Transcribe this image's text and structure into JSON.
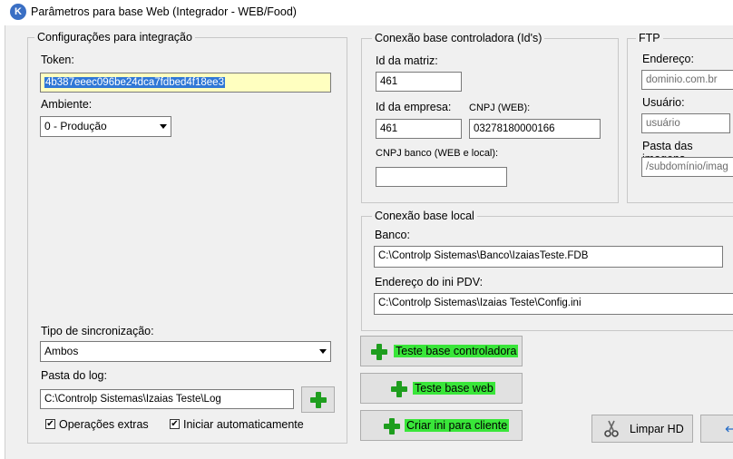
{
  "window": {
    "title": "Parâmetros para base Web (Integrador - WEB/Food)"
  },
  "integracao": {
    "legend": "Configurações para integração",
    "token_label": "Token:",
    "token_value": "4b387eeec096be24dca7fdbed4f18ee3",
    "ambiente_label": "Ambiente:",
    "ambiente_value": "0 - Produção",
    "tipo_sync_label": "Tipo de sincronização:",
    "tipo_sync_value": "Ambos",
    "pasta_log_label": "Pasta do log:",
    "pasta_log_value": "C:\\Controlp Sistemas\\Izaias Teste\\Log",
    "operacoes_extras_label": "Operações extras",
    "operacoes_extras_checked": true,
    "iniciar_auto_label": "Iniciar automaticamente",
    "iniciar_auto_checked": true
  },
  "controladora": {
    "legend": "Conexão base controladora (Id's)",
    "id_matriz_label": "Id da matriz:",
    "id_matriz_value": "461",
    "id_empresa_label": "Id da empresa:",
    "id_empresa_value": "461",
    "cnpj_web_label": "CNPJ (WEB):",
    "cnpj_web_value": "03278180000166",
    "cnpj_banco_label": "CNPJ banco (WEB e local):",
    "cnpj_banco_value": ""
  },
  "ftp": {
    "legend": "FTP",
    "endereco_label": "Endereço:",
    "endereco_placeholder": "dominio.com.br",
    "usuario_label": "Usuário:",
    "usuario_placeholder": "usuário",
    "pasta_imagens_label": "Pasta das imagens",
    "pasta_imagens_placeholder": "/subdomínio/imag"
  },
  "local": {
    "legend": "Conexão base local",
    "banco_label": "Banco:",
    "banco_value": "C:\\Controlp Sistemas\\Banco\\IzaiasTeste.FDB",
    "ini_pdv_label": "Endereço do ini PDV:",
    "ini_pdv_value": "C:\\Controlp Sistemas\\Izaias Teste\\Config.ini"
  },
  "buttons": {
    "teste_controladora": "Teste base controladora",
    "teste_web": "Teste base web",
    "criar_ini": "Criar ini para cliente",
    "limpar_hd": "Limpar HD"
  },
  "icons": {
    "plus": "plus-icon",
    "scissors": "scissors-icon",
    "app": "app-icon"
  },
  "colors": {
    "highlight": "#39e639",
    "token_bg": "#ffffc0",
    "selection": "#3078d6",
    "plus": "#1e9e1e"
  }
}
